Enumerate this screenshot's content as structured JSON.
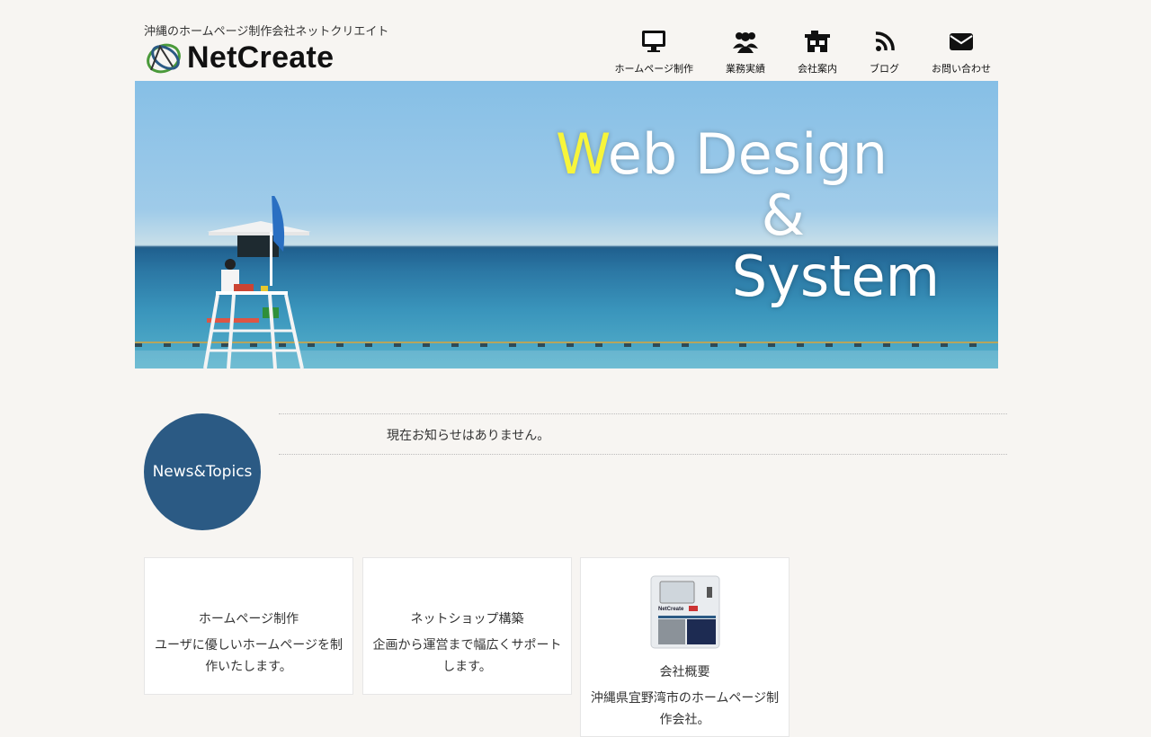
{
  "header": {
    "tagline": "沖縄のホームページ制作会社ネットクリエイト",
    "logo_text": "NetCreate"
  },
  "nav": [
    {
      "label": "ホームページ制作",
      "icon": "monitor-icon"
    },
    {
      "label": "業務実績",
      "icon": "users-icon"
    },
    {
      "label": "会社案内",
      "icon": "building-icon"
    },
    {
      "label": "ブログ",
      "icon": "rss-icon"
    },
    {
      "label": "お問い合わせ",
      "icon": "envelope-icon"
    }
  ],
  "hero": {
    "line1_accent": "W",
    "line1_rest": "eb Design",
    "line2": "&",
    "line3": "System",
    "accent_color": "#f7f53a"
  },
  "news": {
    "badge": "News&Topics",
    "message": "現在お知らせはありません。"
  },
  "cards": [
    {
      "title": "ホームページ制作",
      "desc": "ユーザに優しいホームページを制作いたします。"
    },
    {
      "title": "ネットショップ構築",
      "desc": "企画から運営まで幅広くサポートします。"
    },
    {
      "title": "会社概要",
      "desc": "沖縄県宜野湾市のホームページ制作会社。",
      "image_label": "NetCreate"
    }
  ],
  "colors": {
    "background": "#f7f5f2",
    "badge": "#2b5a84"
  }
}
